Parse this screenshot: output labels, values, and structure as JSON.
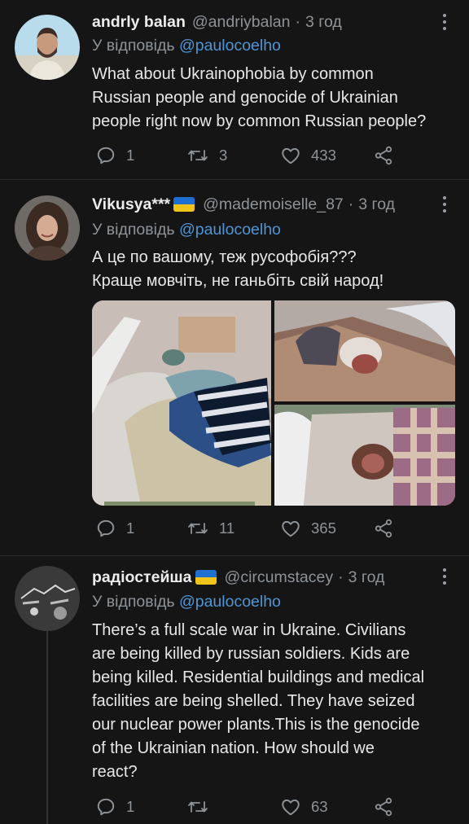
{
  "tweets": [
    {
      "name": "andrly balan",
      "handle": "@andriybalan",
      "separator": "·",
      "time": "3 год",
      "reply_prefix": "У відповідь",
      "reply_to": "@paulocoelho",
      "text": "What about Ukrainophobia by common\nRussian people and genocide of Ukrainian\npeople right now by common Russian people?",
      "replies": "1",
      "retweets": "3",
      "likes": "433"
    },
    {
      "name": "Vikusya***",
      "handle": "@mademoiselle_87",
      "separator": "·",
      "time": "3 год",
      "reply_prefix": "У відповідь",
      "reply_to": "@paulocoelho",
      "text": "А це по вашому, теж русофобія???\nКраще мовчіть, не ганьбіть свій народ!",
      "replies": "1",
      "retweets": "11",
      "likes": "365"
    },
    {
      "name": "радіостейша",
      "handle": "@circumstacey",
      "separator": "·",
      "time": "3 год",
      "reply_prefix": "У відповідь",
      "reply_to": "@paulocoelho",
      "text": "There’s a full scale war in Ukraine. Civilians\nare being killed by russian soldiers. Kids are\nbeing killed. Residential buildings and medical\nfacilities are being shelled. They have seized\nour nuclear power plants.This is the genocide\nof the Ukrainian nation. How should we\nreact?",
      "replies": "1",
      "retweets": "",
      "likes": "63"
    }
  ],
  "colors": {
    "background": "#151515",
    "mention": "#4f95d6",
    "secondary_text": "#8e9398",
    "flag_blue": "#1f6fd1",
    "flag_yellow": "#f0c51a"
  },
  "icons": [
    "reply-icon",
    "retweet-icon",
    "like-icon",
    "share-icon",
    "more-options-icon",
    "ukraine-flag-icon"
  ]
}
